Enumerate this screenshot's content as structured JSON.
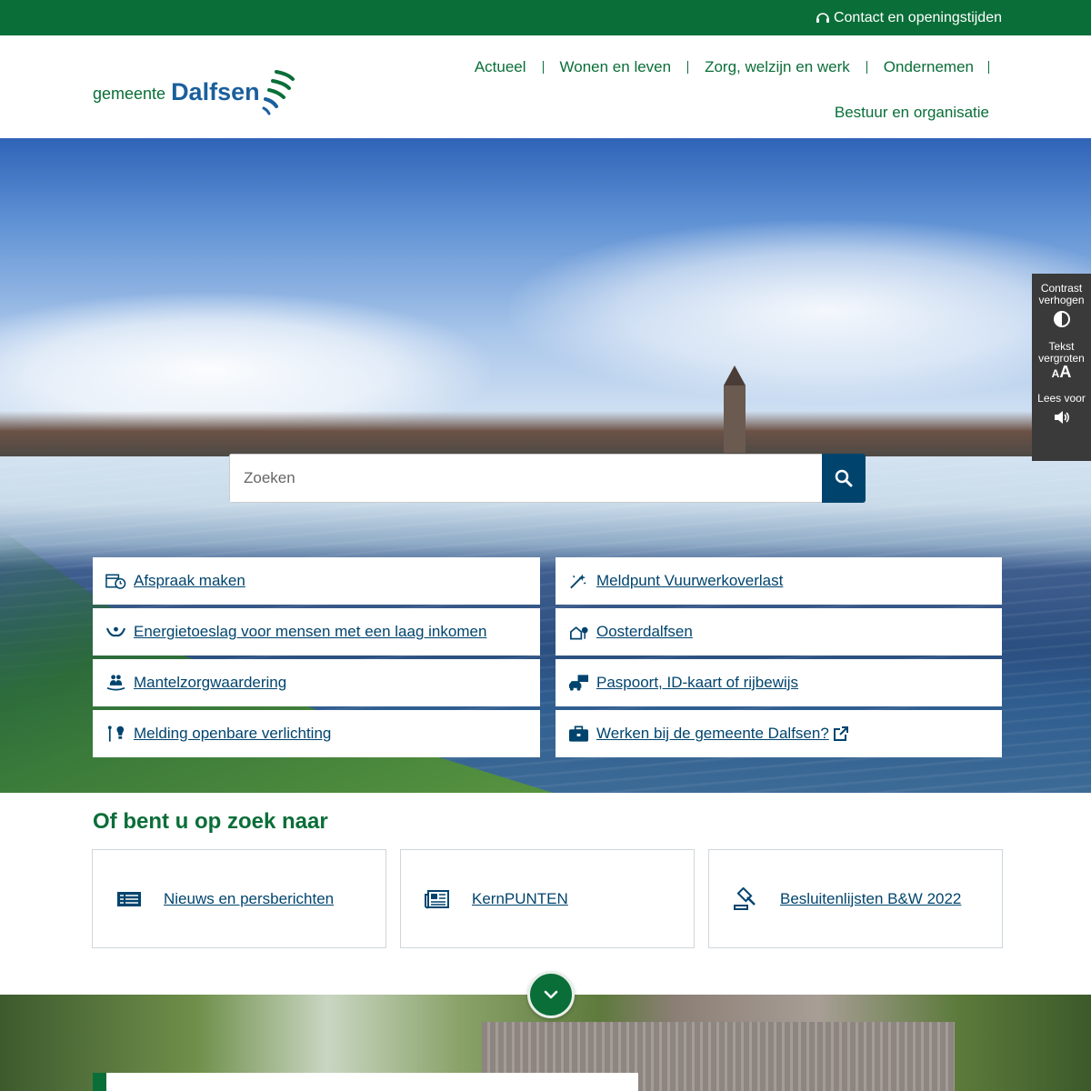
{
  "topbar": {
    "contact_label": "Contact en openingstijden"
  },
  "logo": {
    "small": "gemeente",
    "big": "Dalfsen"
  },
  "nav": {
    "row1": [
      "Actueel",
      "Wonen en leven",
      "Zorg, welzijn en werk",
      "Ondernemen"
    ],
    "row2": [
      "Bestuur en organisatie"
    ]
  },
  "search": {
    "placeholder": "Zoeken"
  },
  "tiles": [
    {
      "label": "Afspraak maken",
      "icon": "calendar-clock-icon"
    },
    {
      "label": "Meldpunt Vuurwerkoverlast",
      "icon": "firework-icon"
    },
    {
      "label": "Energietoeslag voor mensen met een laag inkomen",
      "icon": "hands-icon"
    },
    {
      "label": "Oosterdalfsen",
      "icon": "house-tree-icon"
    },
    {
      "label": "Mantelzorgwaardering",
      "icon": "carer-icon"
    },
    {
      "label": "Paspoort, ID-kaart of rijbewijs",
      "icon": "id-car-icon"
    },
    {
      "label": "Melding openbare verlichting",
      "icon": "streetlight-icon"
    },
    {
      "label": "Werken bij de gemeente Dalfsen?",
      "icon": "briefcase-icon"
    }
  ],
  "a11y": {
    "contrast": "Contrast verhogen",
    "text": "Tekst vergroten",
    "read": "Lees voor",
    "aa_small": "A",
    "aa_big": "A"
  },
  "section": {
    "title": "Of bent u op zoek naar"
  },
  "cards": [
    {
      "label": "Nieuws en persberichten",
      "icon": "news-list-icon"
    },
    {
      "label": "KernPUNTEN",
      "icon": "newspaper-icon"
    },
    {
      "label": "Besluitenlijsten B&W 2022",
      "icon": "gavel-icon"
    }
  ],
  "colors": {
    "green": "#0a6e38",
    "blue": "#00446e",
    "panel": "#3a3a3a"
  }
}
